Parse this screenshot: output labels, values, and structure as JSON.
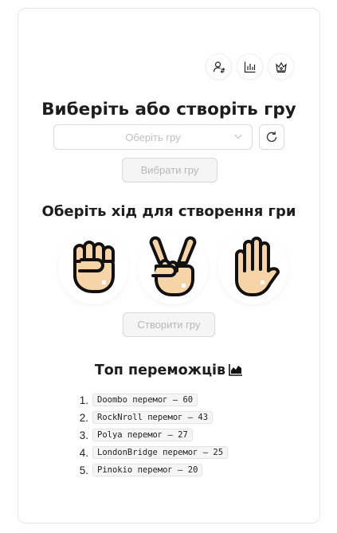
{
  "header": {
    "icons": [
      "user-switch-icon",
      "bar-chart-icon",
      "crown-icon"
    ]
  },
  "title": "Виберіть або створіть гру",
  "game_select": {
    "placeholder": "Оберіть гру",
    "refresh_icon": "refresh-icon"
  },
  "select_button_label": "Вибрати гру",
  "move_prompt": "Оберіть хід для створення гри",
  "moves": [
    {
      "name": "rock",
      "icon": "fist-icon"
    },
    {
      "name": "scissors",
      "icon": "victory-hand-icon"
    },
    {
      "name": "paper",
      "icon": "open-hand-icon"
    }
  ],
  "create_button_label": "Створити гру",
  "leaders_title": "Топ переможців",
  "leaders": [
    {
      "num": "1.",
      "text": "Doombo перемог – 60"
    },
    {
      "num": "2.",
      "text": "RockNroll перемог – 43"
    },
    {
      "num": "3.",
      "text": "Polya перемог – 27"
    },
    {
      "num": "4.",
      "text": "LondonBridge перемог – 25"
    },
    {
      "num": "5.",
      "text": "Pinokio перемог – 20"
    }
  ],
  "colors": {
    "skin": "#f7d3a8",
    "outline": "#111111",
    "disabled_bg": "#f5f5f5",
    "border": "#d9d9d9"
  }
}
